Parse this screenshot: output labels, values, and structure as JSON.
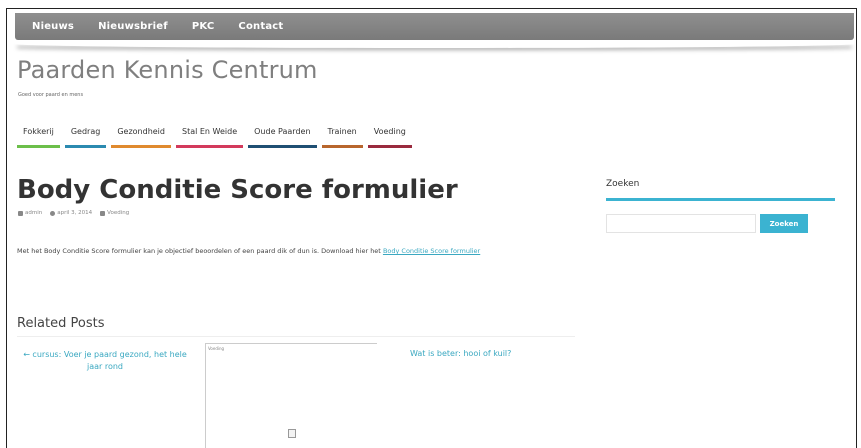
{
  "top_nav": [
    "Nieuws",
    "Nieuwsbrief",
    "PKC",
    "Contact"
  ],
  "site": {
    "title": "Paarden Kennis Centrum",
    "tagline": "Goed voor paard en mens"
  },
  "categories": [
    {
      "label": "Fokkerij",
      "color": "#6cbf4a"
    },
    {
      "label": "Gedrag",
      "color": "#2b8ab0"
    },
    {
      "label": "Gezondheid",
      "color": "#e08a2e"
    },
    {
      "label": "Stal En Weide",
      "color": "#d33a5c"
    },
    {
      "label": "Oude Paarden",
      "color": "#1f4f73"
    },
    {
      "label": "Trainen",
      "color": "#b8662d"
    },
    {
      "label": "Voeding",
      "color": "#9a2a3e"
    }
  ],
  "post": {
    "title": "Body Conditie Score formulier",
    "author": "admin",
    "date": "april 3, 2014",
    "category": "Voeding",
    "body_text": "Met het Body Conditie Score formulier kan je objectief beoordelen of een paard dik of dun is. Download hier het ",
    "link_text": "Body Conditie Score formulier"
  },
  "related": {
    "title": "Related Posts",
    "item1": "← cursus: Voer je paard gezond, het hele jaar rond",
    "item2_label": "Voeding",
    "item3": "Wat is beter: hooi of kuil?"
  },
  "sidebar": {
    "widget_title": "Zoeken",
    "search_placeholder": "",
    "search_button": "Zoeken"
  },
  "colors": {
    "topbar": "#858585",
    "accent": "#3bb3d1",
    "title_gray": "#7f7f7f"
  }
}
